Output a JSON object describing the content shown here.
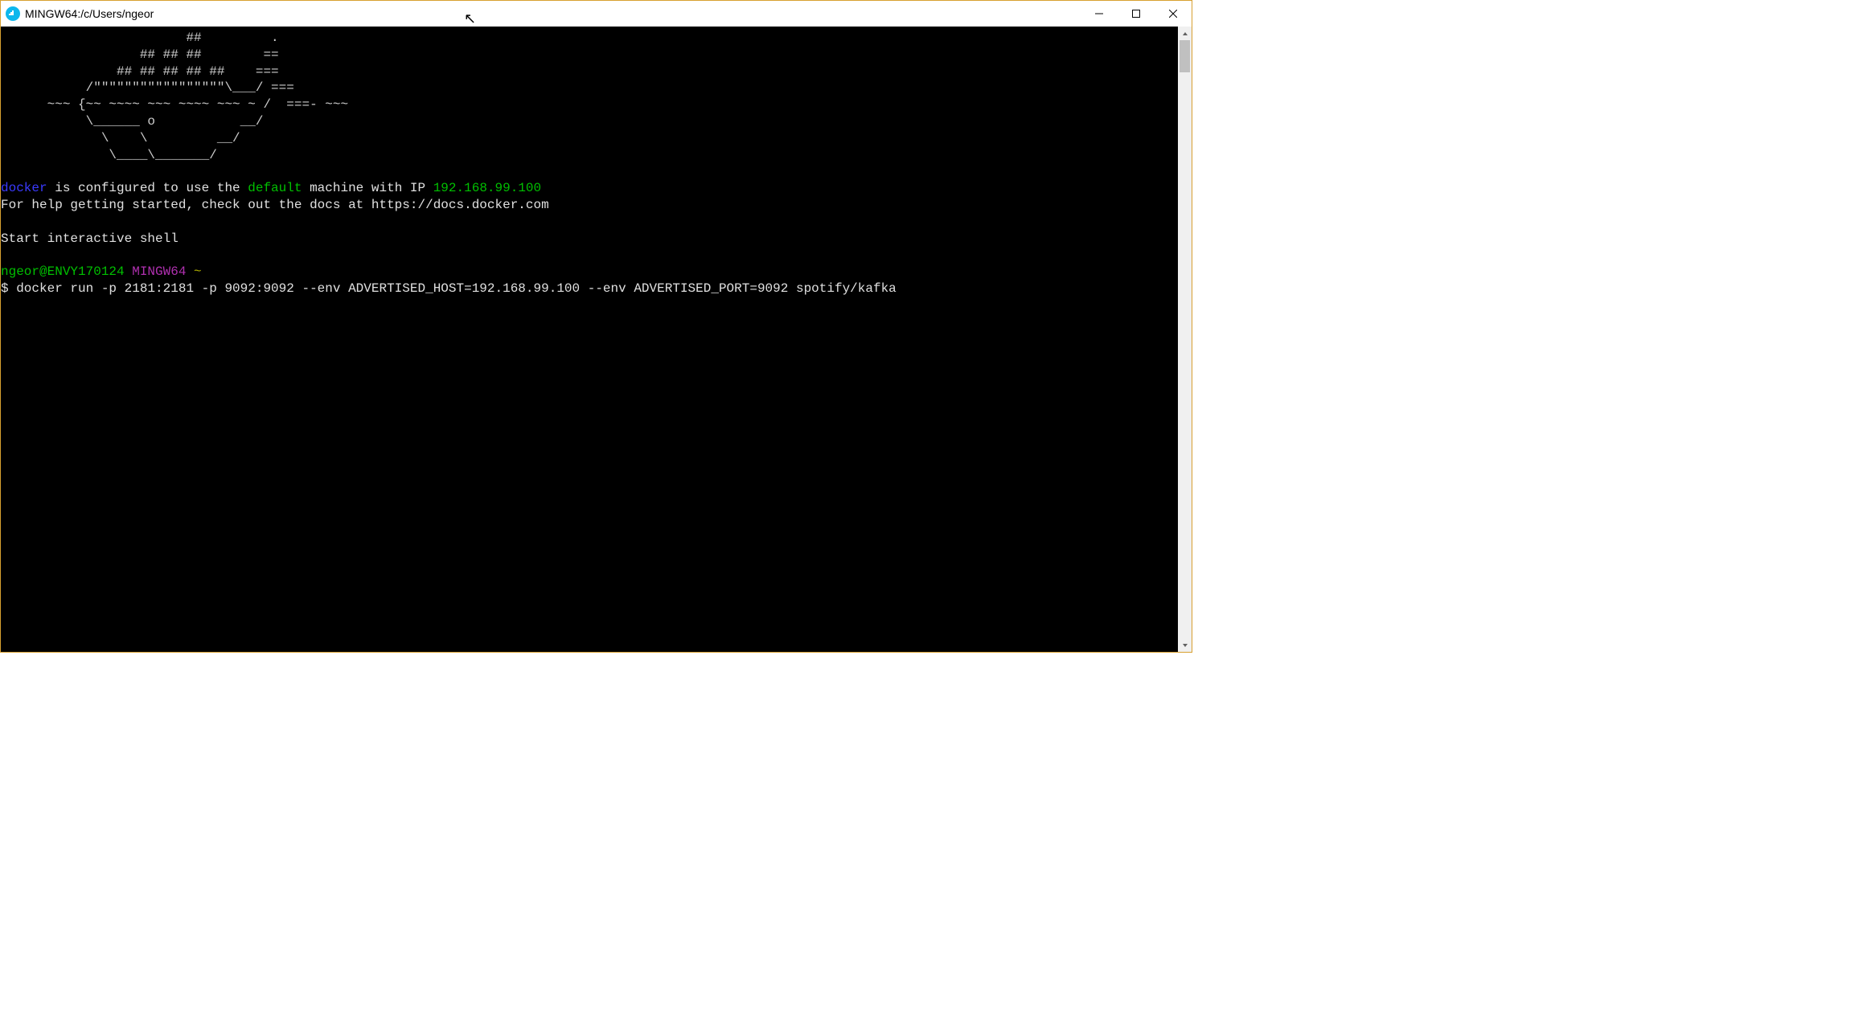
{
  "window": {
    "title": "MINGW64:/c/Users/ngeor"
  },
  "terminal": {
    "ascii_art": "                        ##         .\n                  ## ## ##        ==\n               ## ## ## ## ##    ===\n           /\"\"\"\"\"\"\"\"\"\"\"\"\"\"\"\"\"\\___/ ===\n      ~~~ {~~ ~~~~ ~~~ ~~~~ ~~~ ~ /  ===- ~~~\n           \\______ o           __/\n             \\    \\         __/\n              \\____\\_______/",
    "config_line": {
      "docker_word": "docker",
      "middle": " is configured to use the ",
      "default_word": "default",
      "after_default": " machine with IP ",
      "ip": "192.168.99.100"
    },
    "help_line": "For help getting started, check out the docs at https://docs.docker.com",
    "blank": "",
    "start_shell": "Start interactive shell",
    "prompt": {
      "userhost": "ngeor@ENVY170124",
      "shellname": " MINGW64 ",
      "tilde": "~",
      "dollar": "$ ",
      "command": "docker run -p 2181:2181 -p 9092:9092 --env ADVERTISED_HOST=192.168.99.100 --env ADVERTISED_PORT=9092 spotify/kafka"
    }
  }
}
